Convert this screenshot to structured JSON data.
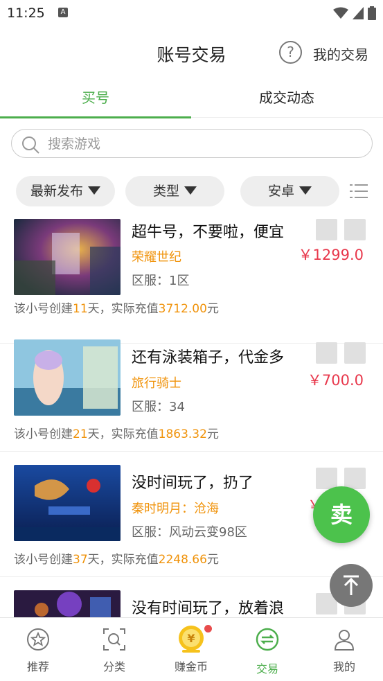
{
  "statusbar": {
    "time": "11:25",
    "notif": "A"
  },
  "header": {
    "title": "账号交易",
    "help": "?",
    "my_trades": "我的交易"
  },
  "tabs": [
    {
      "label": "买号",
      "active": true
    },
    {
      "label": "成交动态",
      "active": false
    }
  ],
  "search": {
    "placeholder": "搜索游戏"
  },
  "filters": [
    {
      "label": "最新发布"
    },
    {
      "label": "类型"
    },
    {
      "label": "安卓"
    }
  ],
  "listings": [
    {
      "title": "超牛号，不要啦，便宜",
      "game": "荣耀世纪",
      "server": "区服：1区",
      "price": "￥1299.0",
      "note_pre": "该小号创建",
      "days": "11",
      "note_mid": "天，实际充值",
      "amount": "3712.00",
      "note_post": "元"
    },
    {
      "title": "还有泳装箱子，代金多",
      "game": "旅行骑士",
      "server": "区服：34",
      "price": "￥700.0",
      "note_pre": "该小号创建",
      "days": "21",
      "note_mid": "天，实际充值",
      "amount": "1863.32",
      "note_post": "元"
    },
    {
      "title": "没时间玩了，扔了",
      "game": "秦时明月：沧海",
      "server": "区服：风动云变98区",
      "price": "￥",
      "note_pre": "该小号创建",
      "days": "37",
      "note_mid": "天，实际充值",
      "amount": "2248.66",
      "note_post": "元"
    },
    {
      "title": "没有时间玩了，放着浪",
      "game": "",
      "server": "",
      "price": "",
      "note_pre": "",
      "days": "",
      "note_mid": "",
      "amount": "",
      "note_post": ""
    }
  ],
  "fab": {
    "sell": "卖"
  },
  "bottomnav": [
    {
      "label": "推荐",
      "icon": "star-icon"
    },
    {
      "label": "分类",
      "icon": "category-search-icon"
    },
    {
      "label": "赚金币",
      "icon": "coin-icon"
    },
    {
      "label": "交易",
      "icon": "trade-icon"
    },
    {
      "label": "我的",
      "icon": "profile-icon"
    }
  ],
  "colors": {
    "accent": "#4cae4c",
    "price": "#e8384c",
    "highlight": "#f0930b"
  }
}
